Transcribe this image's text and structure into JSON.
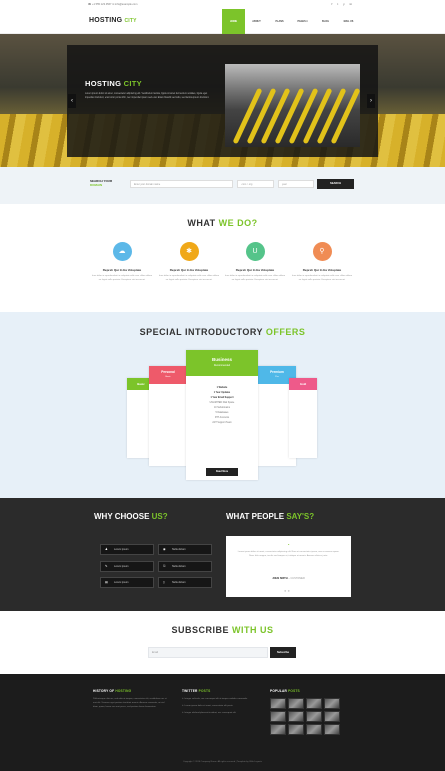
{
  "topbar": {
    "contact": "☎ +1 555 123 4567      ✉ info@example.com",
    "social": [
      "f",
      "t",
      "y",
      "in"
    ]
  },
  "nav": {
    "logo_main": "HOSTING",
    "logo_accent": "CITY",
    "items": [
      {
        "label": "HOME",
        "active": true
      },
      {
        "label": "ABOUT",
        "active": false
      },
      {
        "label": "PLANS",
        "active": false
      },
      {
        "label": "PAGES ▾",
        "active": false
      },
      {
        "label": "BLOG",
        "active": false
      },
      {
        "label": "MAIL US",
        "active": false
      }
    ]
  },
  "hero": {
    "title_main": "HOSTING",
    "title_accent": "CITY",
    "description": "Lorem ipsum dolor sit amet, consectetur adipiscing elit. Vestibulum lacinia, ligula sit amet fermentum sodales, ligula eget imperdiet tincidunt, erat tortor porta nibh, nec imperdiet ipsum sed erat. Etiam blandit sed odio, sed lacinia ipsum tincidunt.",
    "prev": "‹",
    "next": "›"
  },
  "search": {
    "label_line1": "SEARCH YOUR",
    "label_line2": "DOMAIN",
    "domain_placeholder": "Enter your domain name",
    "tld_value": ".com / .org",
    "period_value": "year",
    "button": "SEARCH"
  },
  "what": {
    "heading_main": "WHAT",
    "heading_accent": "WE DO?",
    "features": [
      {
        "icon": "cloud-icon",
        "glyph": "☁",
        "color": "#5cb8e8",
        "title": "Repreh Qui In Ea Voluptate",
        "desc": "Irure dolor in reprehenderit in voluptate velit esse cillum dolore eu fugiat nulla pariatur. Excepteur sint occaecat."
      },
      {
        "icon": "gear-icon",
        "glyph": "✱",
        "color": "#f0a818",
        "title": "Repreh Qui In Ea Voluptate",
        "desc": "Irure dolor in reprehenderit in voluptate velit esse cillum dolore eu fugiat nulla pariatur. Excepteur sint occaecat."
      },
      {
        "icon": "magnet-icon",
        "glyph": "U",
        "color": "#55c48a",
        "title": "Repreh Qui In Ea Voluptate",
        "desc": "Irure dolor in reprehenderit in voluptate velit esse cillum dolore eu fugiat nulla pariatur. Excepteur sint occaecat."
      },
      {
        "icon": "sitemap-icon",
        "glyph": "⚲",
        "color": "#f08c54",
        "title": "Repreh Qui In Ea Voluptate",
        "desc": "Irure dolor in reprehenderit in voluptate velit esse cillum dolore eu fugiat nulla pariatur. Excepteur sint occaecat."
      }
    ]
  },
  "offers": {
    "heading_main": "SPECIAL INTRODUCTORY",
    "heading_accent": "OFFERS",
    "featured": {
      "name": "Business",
      "sub": "Recommended",
      "features": [
        "1 Website",
        "1 Year Updates",
        "1 Year Email Support",
        "",
        "UNLIMITED Disk Space",
        "10 Subdomains",
        "5 Databases",
        "FTP Accounts",
        "24/7 Support Team"
      ],
      "button": "Read More"
    },
    "left_plan": {
      "name": "Personal",
      "sub": "Basic"
    },
    "far_left_plan": {
      "name": "Basic",
      "sub": ""
    },
    "right_plan": {
      "name": "Premium",
      "sub": "Pro"
    },
    "far_right_plan": {
      "name": "Gold",
      "sub": ""
    }
  },
  "why": {
    "heading_main": "WHY CHOOSE",
    "heading_accent": "US?",
    "items": [
      {
        "icon": "user-icon",
        "glyph": "♟",
        "label": "Lorem ipsum"
      },
      {
        "icon": "globe-icon",
        "glyph": "◉",
        "label": "Nulla dictum"
      },
      {
        "icon": "chat-icon",
        "glyph": "✎",
        "label": "Lorem ipsum"
      },
      {
        "icon": "lock-icon",
        "glyph": "⚿",
        "label": "Nulla dictum"
      },
      {
        "icon": "server-icon",
        "glyph": "▤",
        "label": "Lorem ipsum"
      },
      {
        "icon": "mobile-icon",
        "glyph": "▯",
        "label": "Nulla dictum"
      }
    ]
  },
  "testimonials": {
    "heading_main": "WHAT PEOPLE",
    "heading_accent": "SAY'S?",
    "quote_mark": "❝",
    "text": "Lorem ipsum dolor sit amet, consectetur adipiscing elit. Nam ut consectetur ipsum, non accumsan quam. Nunc felis magna, iaculis sed tempor at, tristique at mauris. Aenean ultrices justo.",
    "name": "JOHN SMITH",
    "role": "~ CUSTOMER",
    "dots": "● ●"
  },
  "subscribe": {
    "heading_main": "SUBSCRIBE",
    "heading_accent": "WITH US",
    "placeholder": "Email",
    "button": "Subscribe"
  },
  "footer": {
    "history_main": "HISTORY OF",
    "history_accent": "HOSTING",
    "history_text": "Pellentesque ultrices, sed odio ut tempor, consectetur elit, vestibulum nec et erat elit. Vivamus eget pretium tincidunt mauris. Aenean venenatis, mi nisl diam, quam, lorem non erat purus, sed pretium lorem fermentum.",
    "twitter_main": "TWITTER",
    "twitter_accent": "POSTS",
    "tweets": [
      "Integer vehicula, nec consequat elit ut tempor sodales commodo.",
      "Lorem ipsum dolor sit amet, consectetur elit posts.",
      "Integer eleifend placerat tincidunt, nec consequat elit."
    ],
    "popular_main": "POPULAR",
    "popular_accent": "POSTS",
    "copyright": "Copyright © 2016 Company Name. All rights reserved | Template by Web Layouts"
  },
  "colors": {
    "accent": "#7cc42a",
    "dark": "#222222"
  }
}
